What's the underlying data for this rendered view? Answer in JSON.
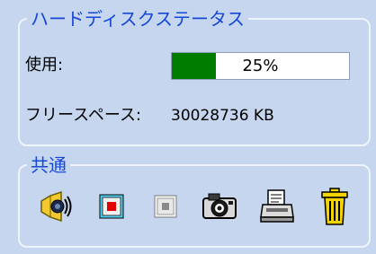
{
  "disk_status": {
    "title": "ハードディスクステータス",
    "usage_label": "使用:",
    "usage_percent": 25,
    "usage_text": "25%",
    "free_space_label": "フリースペース:",
    "free_space_value": "30028736 KB"
  },
  "common": {
    "title": "共通",
    "tools": [
      {
        "icon": "speaker-icon"
      },
      {
        "icon": "record-icon"
      },
      {
        "icon": "stop-icon"
      },
      {
        "icon": "camera-icon"
      },
      {
        "icon": "printer-icon"
      },
      {
        "icon": "trash-icon"
      }
    ]
  },
  "colors": {
    "accent": "#1648d8",
    "panel_bg": "#c5d6ee",
    "progress_fill": "#007d00"
  }
}
